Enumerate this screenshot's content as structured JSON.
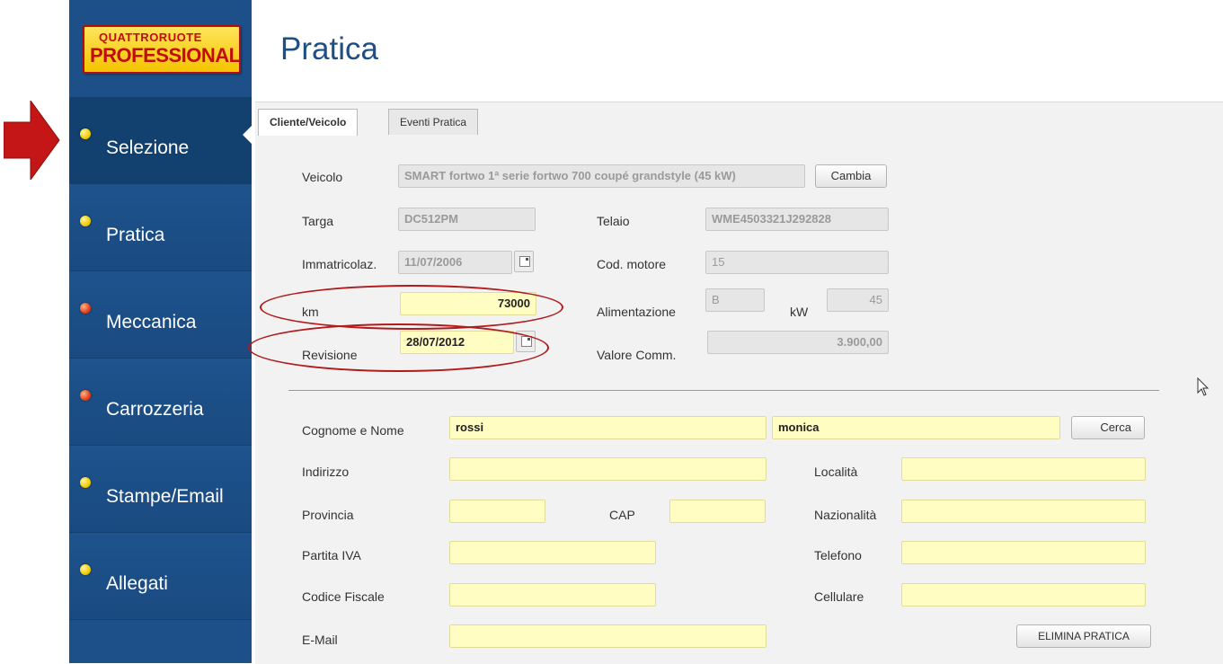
{
  "app": {
    "logo_line1": "QUATTRORUOTE",
    "logo_line2": "PROFESSIONAL",
    "page_title": "Pratica"
  },
  "sidebar": {
    "items": [
      {
        "label": "Selezione",
        "dot": "yellow",
        "active": true
      },
      {
        "label": "Pratica",
        "dot": "yellow"
      },
      {
        "label": "Meccanica",
        "dot": "red"
      },
      {
        "label": "Carrozzeria",
        "dot": "red"
      },
      {
        "label": "Stampe/Email",
        "dot": "yellow"
      },
      {
        "label": "Allegati",
        "dot": "yellow"
      }
    ]
  },
  "tabs": [
    {
      "label": "Cliente/Veicolo",
      "active": true
    },
    {
      "label": "Eventi Pratica"
    }
  ],
  "vehicle": {
    "veicolo_label": "Veicolo",
    "veicolo_value": "SMART fortwo 1ª serie fortwo 700 coupé grandstyle (45 kW)",
    "cambia_button": "Cambia",
    "targa_label": "Targa",
    "targa_value": "DC512PM",
    "telaio_label": "Telaio",
    "telaio_value": "WME4503321J292828",
    "immatricolaz_label": "Immatricolaz.",
    "immatricolaz_value": "11/07/2006",
    "cod_motore_label": "Cod. motore",
    "cod_motore_value": "15",
    "km_label": "km",
    "km_value": "73000",
    "alimentazione_label": "Alimentazione",
    "alimentazione_value": "B",
    "kw_label": "kW",
    "kw_value": "45",
    "revisione_label": "Revisione",
    "revisione_value": "28/07/2012",
    "valore_label": "Valore Comm.",
    "valore_value": "3.900,00"
  },
  "customer": {
    "nome_label": "Cognome e Nome",
    "cognome_value": "rossi",
    "nome_value": "monica",
    "cerca_button": "Cerca",
    "indirizzo_label": "Indirizzo",
    "indirizzo_value": "",
    "localita_label": "Località",
    "localita_value": "",
    "provincia_label": "Provincia",
    "provincia_value": "",
    "cap_label": "CAP",
    "cap_value": "",
    "nazionalita_label": "Nazionalità",
    "nazionalita_value": "",
    "piva_label": "Partita IVA",
    "piva_value": "",
    "telefono_label": "Telefono",
    "telefono_value": "",
    "cf_label": "Codice Fiscale",
    "cf_value": "",
    "cellulare_label": "Cellulare",
    "cellulare_value": "",
    "email_label": "E-Mail",
    "email_value": "",
    "elimina_button": "ELIMINA PRATICA"
  },
  "colors": {
    "sidebar": "#1d5089",
    "title": "#1d4f84",
    "field_highlight": "#fffdc2",
    "annotation_red": "#b01b1b"
  }
}
